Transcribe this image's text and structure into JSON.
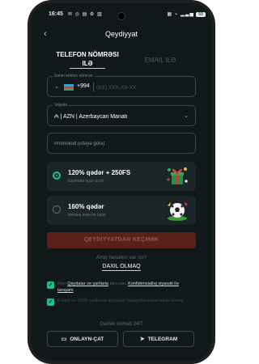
{
  "status_bar": {
    "time": "16:45",
    "left_icons": "✉ ◎ ▤ ⚙ ▥",
    "right_icons": "▦ ⌁ ▂▃▅",
    "battery": "59"
  },
  "header": {
    "back_icon": "chevron-left-icon",
    "title": "Qeydiyyat"
  },
  "tabs": {
    "phone_line1": "TELEFON NÖMRƏSI",
    "phone_line2": "ILƏ",
    "email": "EMAIL ILƏ"
  },
  "phone_field": {
    "label": "Sənin telefon nömrən",
    "country_code": "+994",
    "placeholder": "(XX) XXX-XX-XX",
    "flag_colors": [
      "#3aa0d8",
      "#e03c31",
      "#3fa34d"
    ]
  },
  "currency_field": {
    "label": "Valyuta",
    "value": "₼ | AZN | Azerbaycan Manatı"
  },
  "promo_field": {
    "placeholder": "Promokod (istəyə görə)"
  },
  "bonuses": [
    {
      "title": "120% qədər + 250FS",
      "subtitle": "kazinoda oyun üçün",
      "selected": true,
      "image": "gift-box-icon"
    },
    {
      "title": "160% qədər",
      "subtitle": "idmana mərclər üçün",
      "selected": false,
      "image": "soccer-ball-icon"
    }
  ],
  "register_button": "QEYDİYYATDAN KEÇMƏK",
  "have_account_text": "Artıq hesabın var mı?",
  "login_link": "DAXIL OLMAQ",
  "terms": {
    "prefix": "Mən",
    "link1": "Qaydalar ve şartlarla",
    "middle": "tanışam.",
    "link2": "Konfidensiallıq siyasəti ilə",
    "link2b": "tanışam"
  },
  "sms_consent": "E-poçt və SMS vasitəsilə aksiyalar haqqında məlumatları almaq",
  "support_label": "Dəstek xidməti 24/7",
  "buttons": {
    "chat": "ONLAYN-ÇAT",
    "telegram": "TELEGRAM"
  },
  "colors": {
    "accent": "#1fc08c",
    "register_bg": "#5a1f1a",
    "background": "#10181a"
  }
}
